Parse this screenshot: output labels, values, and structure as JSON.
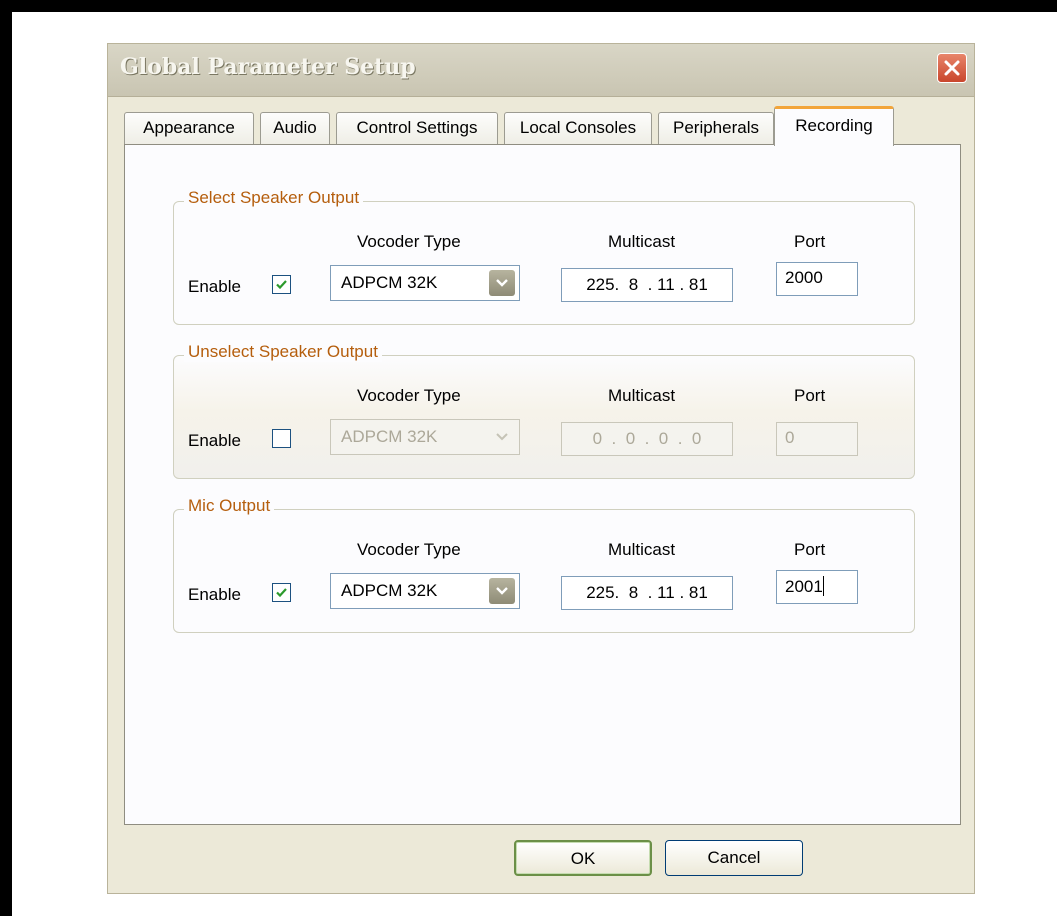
{
  "window": {
    "title": "Global Parameter Setup"
  },
  "tabs": [
    {
      "label": "Appearance",
      "active": false
    },
    {
      "label": "Audio",
      "active": false
    },
    {
      "label": "Control Settings",
      "active": false
    },
    {
      "label": "Local Consoles",
      "active": false
    },
    {
      "label": "Peripherals",
      "active": false
    },
    {
      "label": "Recording",
      "active": true
    }
  ],
  "column_labels": {
    "vocoder": "Vocoder Type",
    "multicast": "Multicast",
    "port": "Port"
  },
  "groups": [
    {
      "label": "Select Speaker Output",
      "enable_label": "Enable",
      "enabled": true,
      "vocoder": "ADPCM 32K",
      "multicast": "225.  8  . 11 . 81",
      "port": "2000"
    },
    {
      "label": "Unselect Speaker Output",
      "enable_label": "Enable",
      "enabled": false,
      "vocoder": "ADPCM 32K",
      "multicast": "0  .  0  .  0  .  0",
      "port": "0"
    },
    {
      "label": "Mic Output",
      "enable_label": "Enable",
      "enabled": true,
      "vocoder": "ADPCM 32K",
      "multicast": "225.  8  . 11 . 81",
      "port": "2001"
    }
  ],
  "buttons": {
    "ok": "OK",
    "cancel": "Cancel"
  },
  "colors": {
    "group_label": "#b55e0d",
    "active_tab_accent": "#f2a53a",
    "checkbox_check": "#2c9a2c",
    "close_button": "#d5533a"
  }
}
